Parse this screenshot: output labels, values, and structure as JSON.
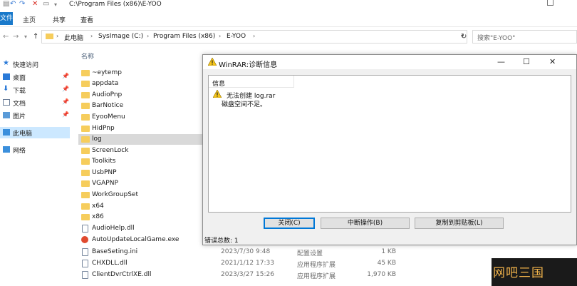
{
  "explorer": {
    "path_title": "C:\\Program Files (x86)\\E-YOO",
    "ribbon_tabs": {
      "file": "文件",
      "home": "主页",
      "share": "共享",
      "view": "查看"
    },
    "breadcrumb": [
      "此电脑",
      "SysImage (C:)",
      "Program Files (x86)",
      "E-YOO"
    ],
    "search_placeholder": "搜索\"E-YOO\"",
    "column_name": "名称",
    "sidebar": [
      {
        "label": "快速访问",
        "icon": "star-icon"
      },
      {
        "label": "桌面",
        "icon": "desktop-icon",
        "pinned": true
      },
      {
        "label": "下载",
        "icon": "download-icon",
        "pinned": true
      },
      {
        "label": "文档",
        "icon": "document-icon",
        "pinned": true
      },
      {
        "label": "图片",
        "icon": "pictures-icon",
        "pinned": true
      },
      {
        "label": "此电脑",
        "icon": "pc-icon",
        "selected": true
      },
      {
        "label": "网络",
        "icon": "network-icon"
      }
    ],
    "files": [
      {
        "name": "~eytemp",
        "type": "folder"
      },
      {
        "name": "appdata",
        "type": "folder"
      },
      {
        "name": "AudioPnp",
        "type": "folder"
      },
      {
        "name": "BarNotice",
        "type": "folder"
      },
      {
        "name": "EyooMenu",
        "type": "folder"
      },
      {
        "name": "HidPnp",
        "type": "folder"
      },
      {
        "name": "log",
        "type": "folder",
        "selected": true
      },
      {
        "name": "ScreenLock",
        "type": "folder"
      },
      {
        "name": "Toolkits",
        "type": "folder"
      },
      {
        "name": "UsbPNP",
        "type": "folder"
      },
      {
        "name": "VGAPNP",
        "type": "folder"
      },
      {
        "name": "WorkGroupSet",
        "type": "folder"
      },
      {
        "name": "x64",
        "type": "folder"
      },
      {
        "name": "x86",
        "type": "folder"
      },
      {
        "name": "AudioHelp.dll",
        "type": "file"
      },
      {
        "name": "AutoUpdateLocalGame.exe",
        "type": "exe"
      },
      {
        "name": "BaseSeting.ini",
        "type": "file",
        "date": "2023/7/30 9:48",
        "kind": "配置设置",
        "size": "1 KB"
      },
      {
        "name": "CHXDLL.dll",
        "type": "file",
        "date": "2021/1/12 17:33",
        "kind": "应用程序扩展",
        "size": "45 KB"
      },
      {
        "name": "ClientDvrCtrlXE.dll",
        "type": "file",
        "date": "2023/3/27 15:26",
        "kind": "应用程序扩展",
        "size": "1,970 KB"
      }
    ]
  },
  "dialog": {
    "title": "WinRAR:诊断信息",
    "column_header": "信息",
    "message_line1": "无法创建 log.rar",
    "message_line2": "磁盘空间不足。",
    "buttons": {
      "close": "关闭(C)",
      "break": "中断操作(B)",
      "copy": "复制到剪贴板(L)"
    },
    "error_count": "错误总数: 1",
    "controls": {
      "minimize": "—",
      "maximize": "☐",
      "close": "✕"
    }
  },
  "watermark": "网吧三国",
  "colors": {
    "accent": "#1979ca",
    "folder": "#f6cd5c",
    "selection": "#cce8ff",
    "warning": "#f5c518"
  }
}
